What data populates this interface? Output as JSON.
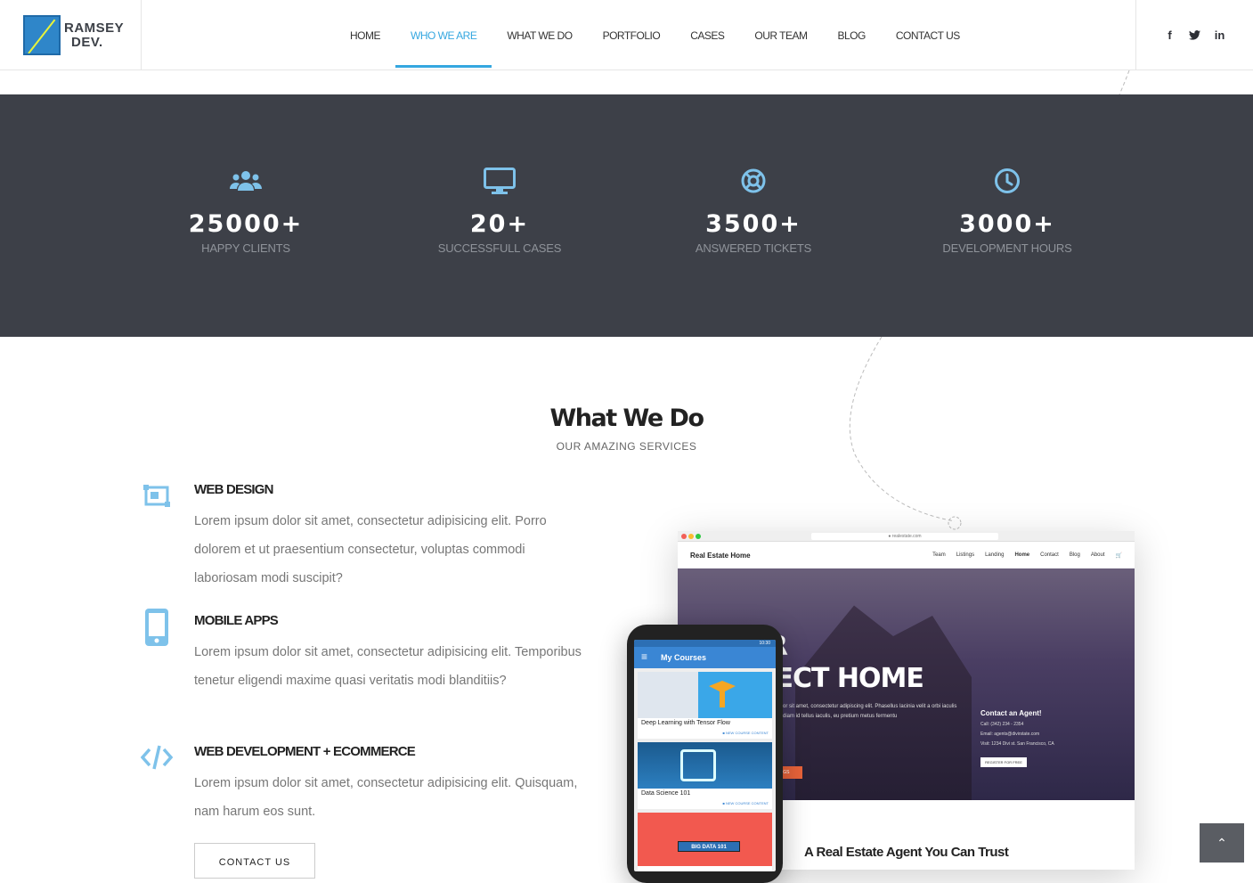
{
  "header": {
    "logo_text": [
      "RAMSEY",
      "DEV."
    ],
    "nav": [
      {
        "label": "HOME",
        "active": false
      },
      {
        "label": "WHO WE ARE",
        "active": true
      },
      {
        "label": "WHAT WE DO",
        "active": false
      },
      {
        "label": "PORTFOLIO",
        "active": false
      },
      {
        "label": "CASES",
        "active": false
      },
      {
        "label": "OUR TEAM",
        "active": false
      },
      {
        "label": "BLOG",
        "active": false
      },
      {
        "label": "CONTACT US",
        "active": false
      }
    ],
    "social": [
      {
        "icon": "facebook-icon",
        "glyph": "f"
      },
      {
        "icon": "twitter-icon",
        "glyph": "t"
      },
      {
        "icon": "linkedin-icon",
        "glyph": "in"
      }
    ]
  },
  "stats": [
    {
      "icon": "users-icon",
      "value": "25000+",
      "label": "HAPPY CLIENTS"
    },
    {
      "icon": "monitor-icon",
      "value": "20+",
      "label": "SUCCESSFULL CASES"
    },
    {
      "icon": "lifebuoy-icon",
      "value": "3500+",
      "label": "ANSWERED TICKETS"
    },
    {
      "icon": "clock-icon",
      "value": "3000+",
      "label": "DEVELOPMENT HOURS"
    }
  ],
  "section": {
    "title": "What We Do",
    "subtitle": "OUR AMAZING SERVICES"
  },
  "services": [
    {
      "icon": "web-design-icon",
      "title": "WEB DESIGN",
      "text": "Lorem ipsum dolor sit amet, consectetur adipisicing elit. Porro dolorem et ut praesentium consectetur, voluptas commodi laboriosam modi suscipit?"
    },
    {
      "icon": "mobile-icon",
      "title": "MOBILE APPS",
      "text": "Lorem ipsum dolor sit amet, consectetur adipisicing elit. Temporibus tenetur eligendi maxime quasi veritatis modi blanditiis?"
    },
    {
      "icon": "code-icon",
      "title": "WEB DEVELOPMENT + ECOMMERCE",
      "text": "Lorem ipsum dolor sit amet, consectetur adipisicing elit. Quisquam, nam harum eos sunt."
    }
  ],
  "contact_button": "CONTACT US",
  "mockup": {
    "url": "● realestate.com",
    "site_logo": "Real Estate Home",
    "site_links": [
      "Team",
      "Listings",
      "Landing",
      "Home",
      "Contact",
      "Blog",
      "About",
      "🛒"
    ],
    "hero_title": [
      "D YOUR",
      "FECT HOME"
    ],
    "hero_desc": "or sit amet, consectetur adipiscing elit. Phasellus lacinia velit a orbi iaculis diam id tellus iaculis, eu pretium metus fermentu",
    "hero_btn": "NGS",
    "agent_title": "Contact an Agent!",
    "agent_lines": [
      "Call: (342) 234 - 2354",
      "Email: agents@divirstate.com",
      "Visit: 1234 Divi st. San Francisco, CA"
    ],
    "agent_btn": "REGISTER FOR FREE",
    "trust": "A Real Estate Agent You Can Trust"
  },
  "phone": {
    "time": "10:30",
    "app_title": "My Courses",
    "cards": [
      {
        "title": "Deep Learning with Tensor Flow",
        "tag": "■ NEW COURSE CONTENT"
      },
      {
        "title": "Data Science 101",
        "tag": "■ NEW COURSE CONTENT"
      },
      {
        "title": "BIG DATA 101",
        "tag": ""
      }
    ]
  },
  "back_to_top": "⌃"
}
